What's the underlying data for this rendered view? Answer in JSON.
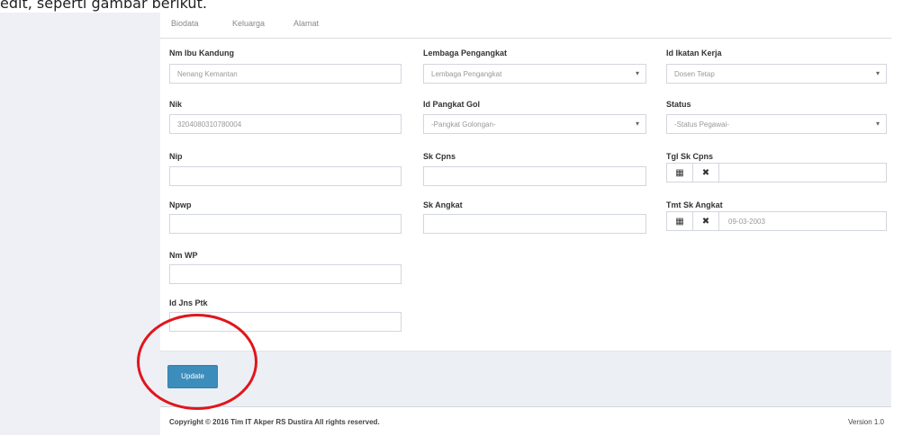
{
  "caption": "edit, seperti gambar berikut.",
  "tabs": [
    "Biodata",
    "Keluarga",
    "Alamat"
  ],
  "fields": {
    "nm_ibu_kandung": {
      "label": "Nm Ibu Kandung",
      "value": "Nenang Kemantan"
    },
    "lembaga_pengangkat": {
      "label": "Lembaga Pengangkat",
      "value": "Lembaga Pengangkat"
    },
    "id_ikatan_kerja": {
      "label": "Id Ikatan Kerja",
      "value": "Dosen Tetap"
    },
    "nik": {
      "label": "Nik",
      "value": "3204080310780004"
    },
    "id_pangkat_gol": {
      "label": "Id Pangkat Gol",
      "value": "-Pangkat Golongan-"
    },
    "status": {
      "label": "Status",
      "value": "-Status Pegawai-"
    },
    "nip": {
      "label": "Nip",
      "value": ""
    },
    "sk_cpns": {
      "label": "Sk Cpns",
      "value": ""
    },
    "tgl_sk_cpns": {
      "label": "Tgl Sk Cpns",
      "value": ""
    },
    "npwp": {
      "label": "Npwp",
      "value": ""
    },
    "sk_angkat": {
      "label": "Sk Angkat",
      "value": ""
    },
    "tmt_sk_angkat": {
      "label": "Tmt Sk Angkat",
      "value": "09-03-2003"
    },
    "nm_wp": {
      "label": "Nm WP",
      "value": ""
    },
    "id_jns_ptk": {
      "label": "Id Jns Ptk",
      "value": ""
    }
  },
  "icons": {
    "calendar": "▦",
    "clear": "✖"
  },
  "buttons": {
    "update": "Update"
  },
  "footer": {
    "copyright": "Copyright © 2016 Tim IT Akper RS Dustira All rights reserved.",
    "version": "Version 1.0"
  }
}
